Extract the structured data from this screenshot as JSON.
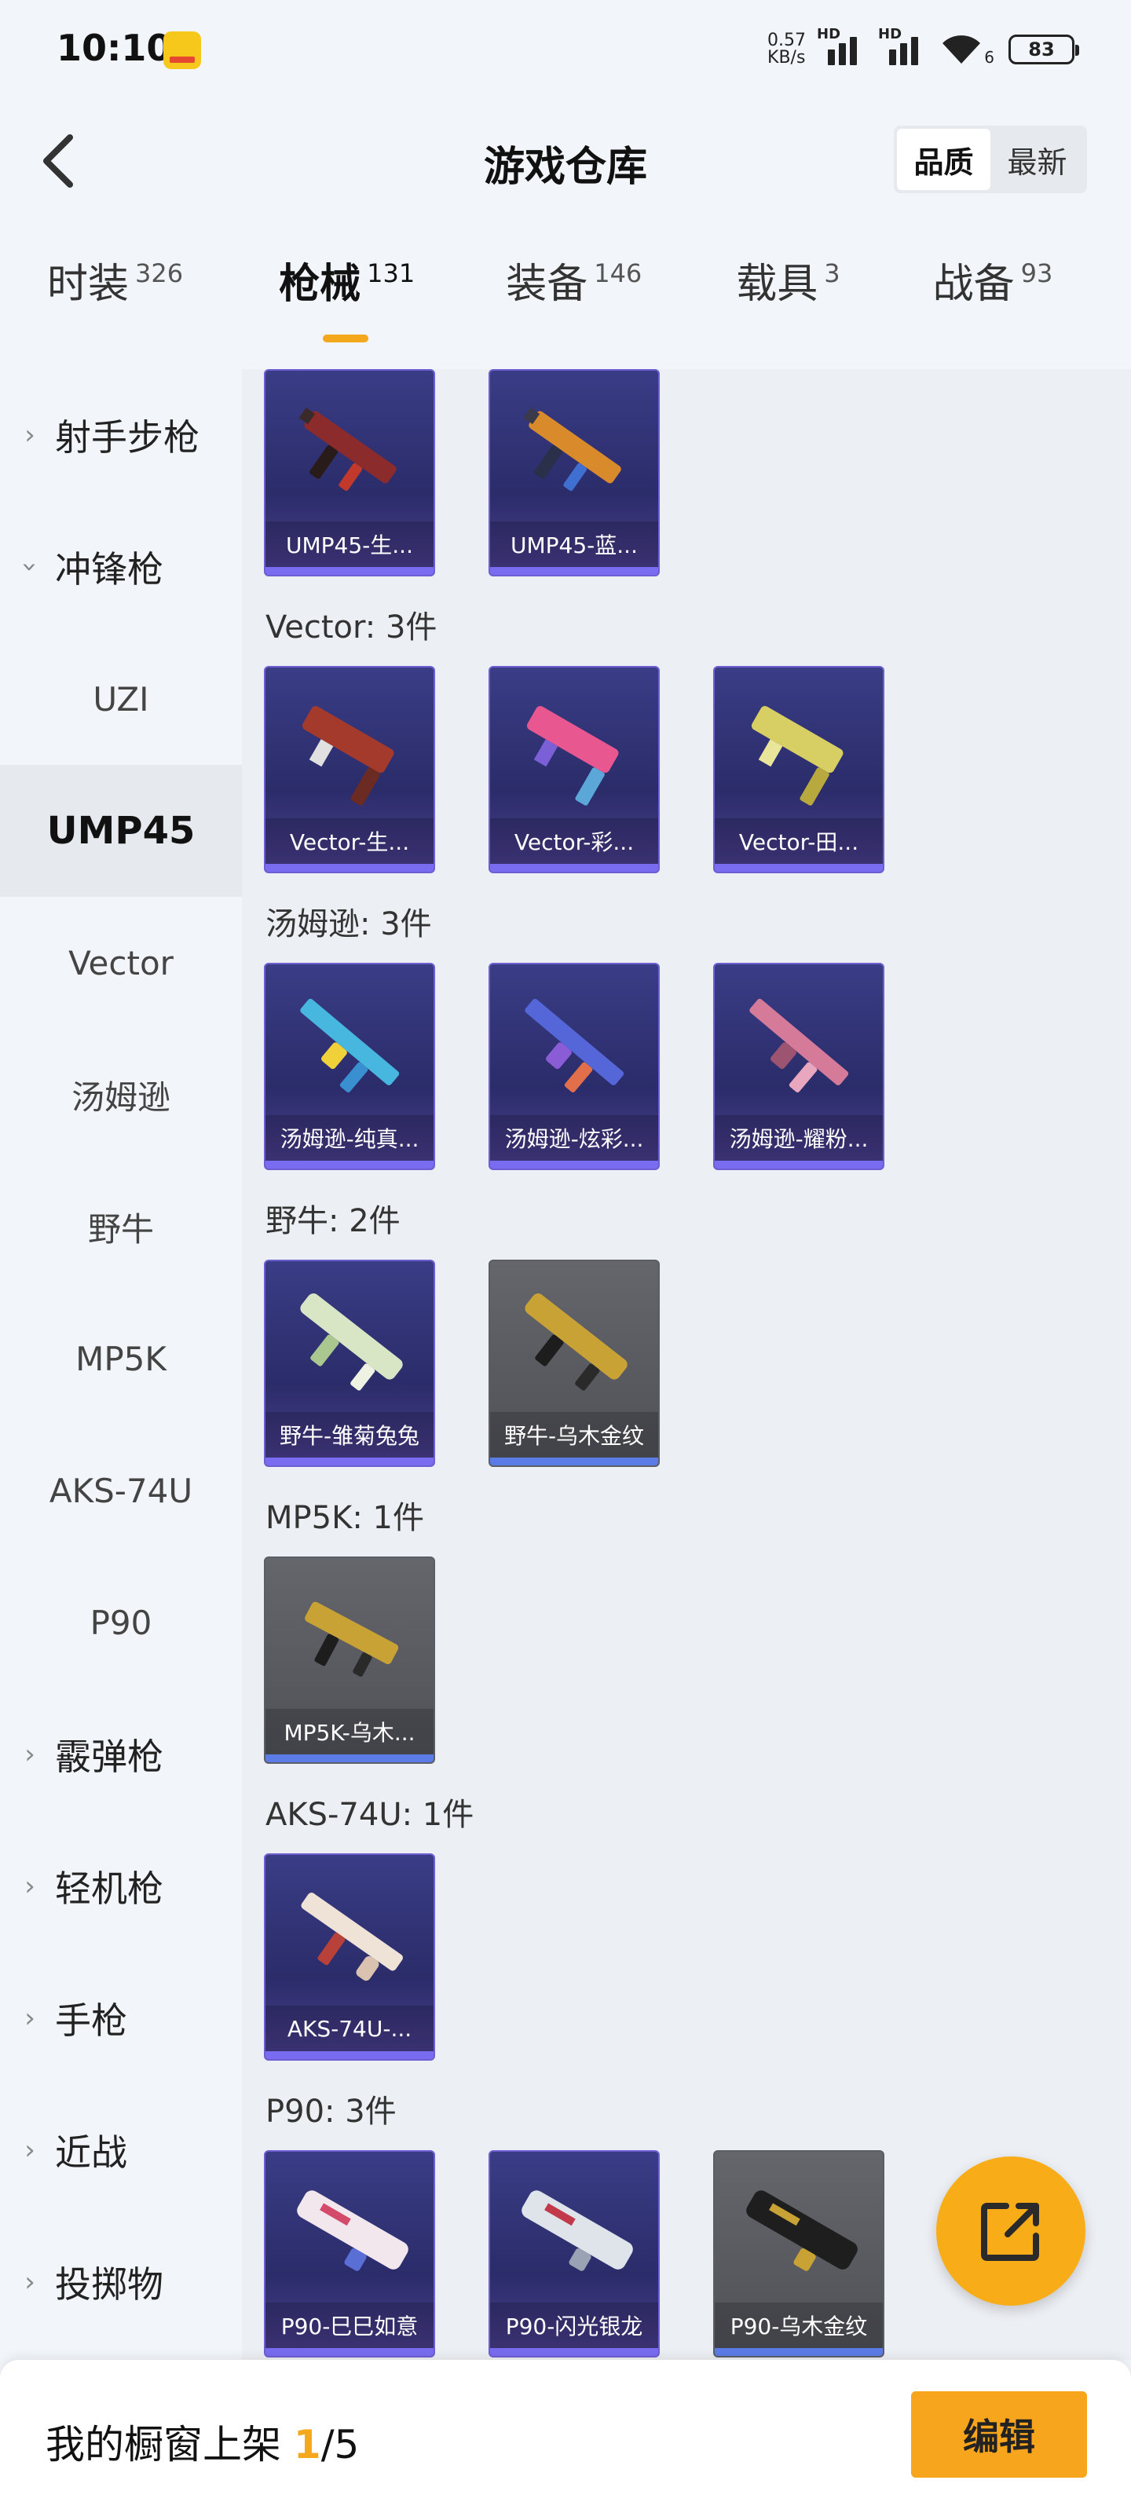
{
  "status": {
    "time": "10:10",
    "speed_value": "0.57",
    "speed_unit": "KB/s",
    "hd1": "HD",
    "hd2": "HD",
    "wifi_num": "6",
    "battery": "83"
  },
  "header": {
    "title": "游戏仓库",
    "sort_quality": "品质",
    "sort_latest": "最新"
  },
  "tabs": [
    {
      "label": "时装",
      "count": "326"
    },
    {
      "label": "枪械",
      "count": "131"
    },
    {
      "label": "装备",
      "count": "146"
    },
    {
      "label": "载具",
      "count": "3"
    },
    {
      "label": "战备",
      "count": "93"
    }
  ],
  "sidebar": {
    "items": [
      {
        "label": "射手步枪",
        "type": "group",
        "expanded": false
      },
      {
        "label": "冲锋枪",
        "type": "group",
        "expanded": true
      },
      {
        "label": "UZI",
        "type": "sub"
      },
      {
        "label": "UMP45",
        "type": "sub",
        "active": true
      },
      {
        "label": "Vector",
        "type": "sub"
      },
      {
        "label": "汤姆逊",
        "type": "sub"
      },
      {
        "label": "野牛",
        "type": "sub"
      },
      {
        "label": "MP5K",
        "type": "sub"
      },
      {
        "label": "AKS-74U",
        "type": "sub"
      },
      {
        "label": "P90",
        "type": "sub"
      },
      {
        "label": "霰弹枪",
        "type": "group",
        "expanded": false
      },
      {
        "label": "轻机枪",
        "type": "group",
        "expanded": false
      },
      {
        "label": "手枪",
        "type": "group",
        "expanded": false
      },
      {
        "label": "近战",
        "type": "group",
        "expanded": false
      },
      {
        "label": "投掷物",
        "type": "group",
        "expanded": false
      }
    ]
  },
  "groups": [
    {
      "title": "",
      "items": [
        {
          "label": "UMP45-生...",
          "rarity": "purple",
          "art": "ump-red"
        },
        {
          "label": "UMP45-蓝...",
          "rarity": "purple",
          "art": "ump-blue"
        }
      ]
    },
    {
      "title": "Vector: 3件",
      "items": [
        {
          "label": "Vector-生...",
          "rarity": "purple",
          "art": "vector-red"
        },
        {
          "label": "Vector-彩...",
          "rarity": "purple",
          "art": "vector-pink"
        },
        {
          "label": "Vector-田...",
          "rarity": "purple",
          "art": "vector-gold"
        }
      ]
    },
    {
      "title": "汤姆逊: 3件",
      "items": [
        {
          "label": "汤姆逊-纯真...",
          "rarity": "purple",
          "art": "tommy-yellow"
        },
        {
          "label": "汤姆逊-炫彩...",
          "rarity": "purple",
          "art": "tommy-blue"
        },
        {
          "label": "汤姆逊-耀粉...",
          "rarity": "purple",
          "art": "tommy-pink"
        }
      ]
    },
    {
      "title": "野牛: 2件",
      "items": [
        {
          "label": "野牛-雏菊兔兔",
          "rarity": "purple",
          "art": "bizon-white"
        },
        {
          "label": "野牛-乌木金纹",
          "rarity": "grey",
          "art": "bizon-gold"
        }
      ]
    },
    {
      "title": "MP5K: 1件",
      "items": [
        {
          "label": "MP5K-乌木...",
          "rarity": "grey",
          "art": "mp5k-gold"
        }
      ]
    },
    {
      "title": "AKS-74U: 1件",
      "items": [
        {
          "label": "AKS-74U-...",
          "rarity": "purple",
          "art": "aks-white"
        }
      ]
    },
    {
      "title": "P90: 3件",
      "items": [
        {
          "label": "P90-巳巳如意",
          "rarity": "purple",
          "art": "p90-white"
        },
        {
          "label": "P90-闪光银龙",
          "rarity": "purple",
          "art": "p90-silver"
        },
        {
          "label": "P90-乌木金纹",
          "rarity": "grey",
          "art": "p90-gold"
        }
      ]
    }
  ],
  "colors": {
    "accent": "#f4a81b",
    "purple_rarity": "#6d5fd1",
    "grey_rarity": "#5b7ce6"
  },
  "bottom": {
    "showcase_prefix": "我的橱窗上架 ",
    "showcase_current": "1",
    "showcase_total": "/5",
    "edit_label": "编辑"
  },
  "fab": {
    "icon": "share-external-icon"
  }
}
